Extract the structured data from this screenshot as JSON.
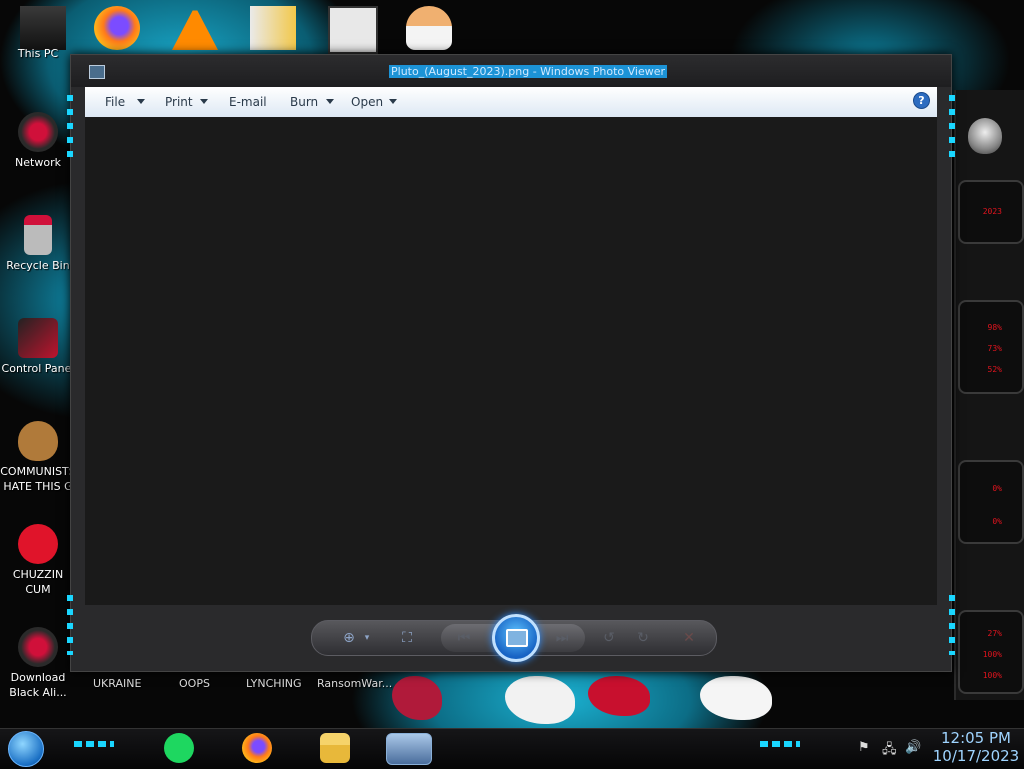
{
  "desktop": {
    "icons": [
      {
        "label": "This PC",
        "icon": "monitor-icon"
      },
      {
        "label": "Network",
        "icon": "alien-network-icon"
      },
      {
        "label": "Recycle Bin",
        "icon": "recycle-bin-icon"
      },
      {
        "label": "Control Panel",
        "icon": "control-panel-icon"
      },
      {
        "label": "COMMUNISTS HATE THIS G",
        "icon": "money-bag-icon"
      },
      {
        "label": "CHUZZIN CUM",
        "icon": "red-monster-icon"
      },
      {
        "label": "Download Black Ali...",
        "icon": "alien-download-icon"
      }
    ],
    "bottom_labels": [
      "UKRAINE",
      "OOPS",
      "LYNCHING",
      "RansomWar..."
    ]
  },
  "gadget": {
    "values": [
      "2023",
      "98%",
      "73%",
      "52%",
      "0%",
      "0%",
      "27%",
      "100%",
      "100%"
    ]
  },
  "window": {
    "title": "Pluto_(August_2023).png - Windows Photo Viewer",
    "menu": {
      "file": "File",
      "print": "Print",
      "email": "E-mail",
      "burn": "Burn",
      "open": "Open"
    },
    "help": "?"
  },
  "controls": {
    "zoom": "⊕",
    "fit": "⛶",
    "prev": "⏮",
    "next": "⏭",
    "rotate_ccw": "↺",
    "rotate_cw": "↻",
    "delete": "✕"
  },
  "taskbar": {
    "time": "12:05 PM",
    "date": "10/17/2023"
  },
  "colors": {
    "accent_cyan": "#1ad6ff",
    "gadget_red": "#e0141e",
    "menubar": "#dde8f4"
  }
}
